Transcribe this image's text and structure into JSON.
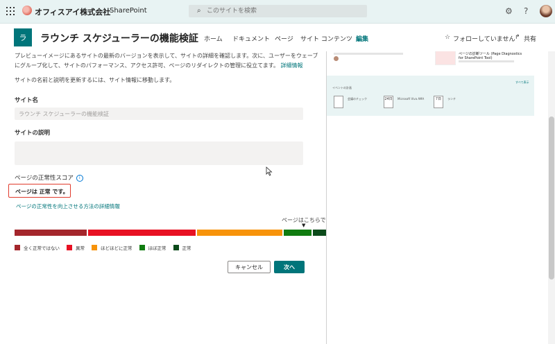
{
  "suitebar": {
    "org_name": "オフィスアイ株式会社",
    "app_name": "SharePoint",
    "search_placeholder": "このサイトを検索",
    "help_label": "?"
  },
  "site": {
    "logo_letter": "ラ",
    "title": "ラウンチ スケジューラーの機能検証",
    "nav": [
      "ホーム",
      "ドキュメント",
      "ページ",
      "サイト コンテンツ",
      "編集"
    ],
    "follow_label": "フォローしていません",
    "share_label": "共有"
  },
  "panel": {
    "intro": "プレビューイメージにあるサイトの最新のバージョンを表示して、サイトの詳細を確認します。次に、ユーザーをウェーブにグループ化して、サイトのパフォーマンス、アクセス許可、ページのリダイレクトの管理に役立てます。",
    "intro_link": "詳細情報",
    "info_note": "サイトの名前と説明を更新するには、サイト情報に移動します。",
    "site_name_label": "サイト名",
    "site_name_value": "ラウンチ スケジューラーの機能検証",
    "description_label": "サイトの説明",
    "description_value": "",
    "health_label": "ページの正常性スコア",
    "health_status": "ページは 正常 です。",
    "improve_link": "ページの正常性を向上させる方法の詳細情報",
    "pointer_label": "ページはこちらです",
    "pointer_arrow": "▼",
    "legend": [
      {
        "label": "全く正常ではない",
        "color": "#a4262c"
      },
      {
        "label": "異常",
        "color": "#e81123"
      },
      {
        "label": "ほどほどに正常",
        "color": "#f7930a"
      },
      {
        "label": "ほぼ正常",
        "color": "#107c10"
      },
      {
        "label": "正常",
        "color": "#0b4a1a"
      }
    ],
    "cancel_label": "キャンセル",
    "next_label": "次へ"
  },
  "preview": {
    "news_title": "ページの診断ツール (Page Diagnostics for SharePoint Tool)",
    "events_heading": "イベントの計画",
    "see_all": "すべて表示",
    "events": [
      {
        "title": "会議のチェック",
        "day": ""
      },
      {
        "title": "Microsoft Viva AMA",
        "day": "24日"
      },
      {
        "title": "ランチ",
        "day": "7日"
      }
    ]
  }
}
